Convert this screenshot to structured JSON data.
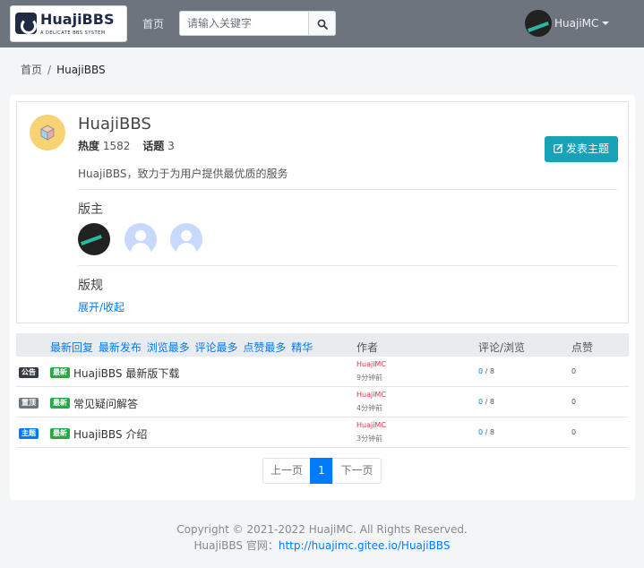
{
  "navbar": {
    "logo_title": "HuajiBBS",
    "logo_subtitle": "A DELICATE BBS SYSTEM",
    "home_label": "首页",
    "search_placeholder": "请输入关键字",
    "user_name": "HuajiMC"
  },
  "breadcrumb": {
    "home": "首页",
    "separator": "/",
    "current": "HuajiBBS"
  },
  "board": {
    "name": "HuajiBBS",
    "heat_label": "热度",
    "heat_value": "1582",
    "topics_label": "话题",
    "topics_value": "3",
    "description": "HuajiBBS，致力于为用户提供最优质的服务",
    "post_button": "发表主题",
    "moderators_title": "版主",
    "rules_title": "版规",
    "expand_label": "展开/收起"
  },
  "table": {
    "sort_links": [
      "最新回复",
      "最新发布",
      "浏览最多",
      "评论最多",
      "点赞最多",
      "精华"
    ],
    "col_author": "作者",
    "col_views": "评论/浏览",
    "col_likes": "点赞",
    "rows": [
      {
        "type": "公告",
        "new_badge": "最新",
        "title": "HuajiBBS 最新版下载",
        "author": "HuajiMC",
        "time": "9分钟前",
        "comments": "0",
        "views": "/ 8",
        "likes": "0"
      },
      {
        "type": "置顶",
        "new_badge": "最新",
        "title": "常见疑问解答",
        "author": "HuajiMC",
        "time": "4分钟前",
        "comments": "0",
        "views": "/ 8",
        "likes": "0"
      },
      {
        "type": "主题",
        "new_badge": "最新",
        "title": "HuajiBBS 介绍",
        "author": "HuajiMC",
        "time": "3分钟前",
        "comments": "0",
        "views": "/ 8",
        "likes": "0"
      }
    ]
  },
  "pagination": {
    "prev": "上一页",
    "current": "1",
    "next": "下一页"
  },
  "footer": {
    "copyright": "Copyright © 2021-2022 HuajiMC. All Rights Reserved.",
    "site_label": "HuajiBBS 官网：",
    "site_link": "http://huajimc.gitee.io/HuajiBBS"
  },
  "colors": {
    "navbar": "#6c757d",
    "primary": "#007bff",
    "info": "#17a2b8",
    "success": "#28a745",
    "danger": "#dc3545"
  }
}
